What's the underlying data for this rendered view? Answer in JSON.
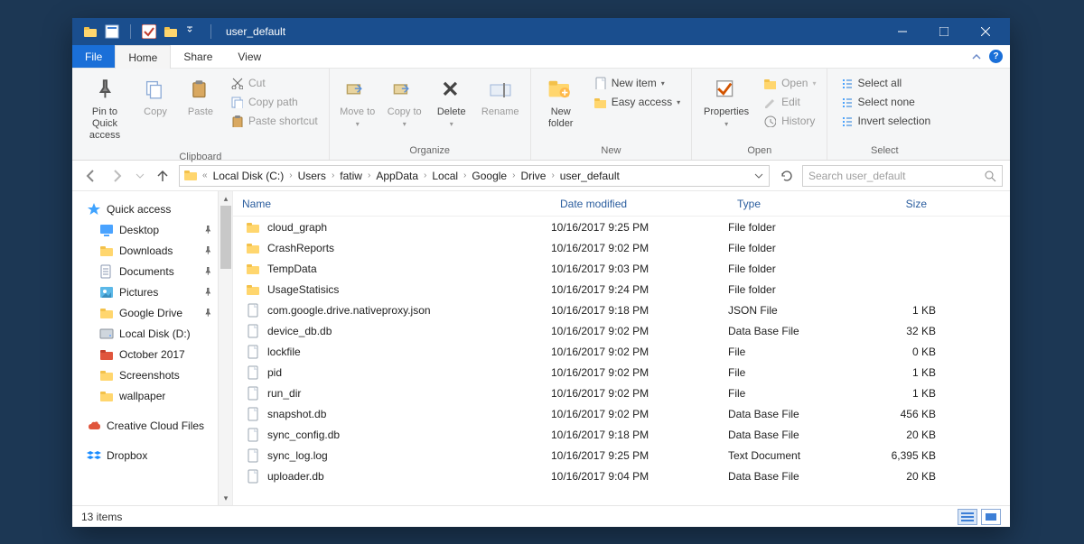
{
  "window": {
    "title": "user_default"
  },
  "tabs": {
    "file": "File",
    "home": "Home",
    "share": "Share",
    "view": "View"
  },
  "ribbon": {
    "clipboard": {
      "label": "Clipboard",
      "pin": "Pin to Quick access",
      "copy": "Copy",
      "paste": "Paste",
      "cut": "Cut",
      "copy_path": "Copy path",
      "paste_shortcut": "Paste shortcut"
    },
    "organize": {
      "label": "Organize",
      "move_to": "Move to",
      "copy_to": "Copy to",
      "delete": "Delete",
      "rename": "Rename"
    },
    "new": {
      "label": "New",
      "new_folder": "New folder",
      "new_item": "New item",
      "easy_access": "Easy access"
    },
    "open": {
      "label": "Open",
      "properties": "Properties",
      "open": "Open",
      "edit": "Edit",
      "history": "History"
    },
    "select": {
      "label": "Select",
      "select_all": "Select all",
      "select_none": "Select none",
      "invert": "Invert selection"
    }
  },
  "breadcrumb": [
    "Local Disk (C:)",
    "Users",
    "fatiw",
    "AppData",
    "Local",
    "Google",
    "Drive",
    "user_default"
  ],
  "search": {
    "placeholder": "Search user_default"
  },
  "sidebar": {
    "quick_access": "Quick access",
    "items": [
      {
        "label": "Desktop",
        "pinned": true,
        "icon": "desktop"
      },
      {
        "label": "Downloads",
        "pinned": true,
        "icon": "folder"
      },
      {
        "label": "Documents",
        "pinned": true,
        "icon": "documents"
      },
      {
        "label": "Pictures",
        "pinned": true,
        "icon": "pictures"
      },
      {
        "label": "Google Drive",
        "pinned": true,
        "icon": "folder"
      },
      {
        "label": "Local Disk (D:)",
        "pinned": false,
        "icon": "disk"
      },
      {
        "label": "October 2017",
        "pinned": false,
        "icon": "folder-red"
      },
      {
        "label": "Screenshots",
        "pinned": false,
        "icon": "folder"
      },
      {
        "label": "wallpaper",
        "pinned": false,
        "icon": "folder"
      }
    ],
    "cc": "Creative Cloud Files",
    "dropbox": "Dropbox"
  },
  "columns": {
    "name": "Name",
    "date": "Date modified",
    "type": "Type",
    "size": "Size"
  },
  "files": [
    {
      "name": "cloud_graph",
      "date": "10/16/2017 9:25 PM",
      "type": "File folder",
      "size": "",
      "icon": "folder"
    },
    {
      "name": "CrashReports",
      "date": "10/16/2017 9:02 PM",
      "type": "File folder",
      "size": "",
      "icon": "folder"
    },
    {
      "name": "TempData",
      "date": "10/16/2017 9:03 PM",
      "type": "File folder",
      "size": "",
      "icon": "folder"
    },
    {
      "name": "UsageStatisics",
      "date": "10/16/2017 9:24 PM",
      "type": "File folder",
      "size": "",
      "icon": "folder"
    },
    {
      "name": "com.google.drive.nativeproxy.json",
      "date": "10/16/2017 9:18 PM",
      "type": "JSON File",
      "size": "1 KB",
      "icon": "file"
    },
    {
      "name": "device_db.db",
      "date": "10/16/2017 9:02 PM",
      "type": "Data Base File",
      "size": "32 KB",
      "icon": "file"
    },
    {
      "name": "lockfile",
      "date": "10/16/2017 9:02 PM",
      "type": "File",
      "size": "0 KB",
      "icon": "file"
    },
    {
      "name": "pid",
      "date": "10/16/2017 9:02 PM",
      "type": "File",
      "size": "1 KB",
      "icon": "file"
    },
    {
      "name": "run_dir",
      "date": "10/16/2017 9:02 PM",
      "type": "File",
      "size": "1 KB",
      "icon": "file"
    },
    {
      "name": "snapshot.db",
      "date": "10/16/2017 9:02 PM",
      "type": "Data Base File",
      "size": "456 KB",
      "icon": "file"
    },
    {
      "name": "sync_config.db",
      "date": "10/16/2017 9:18 PM",
      "type": "Data Base File",
      "size": "20 KB",
      "icon": "file"
    },
    {
      "name": "sync_log.log",
      "date": "10/16/2017 9:25 PM",
      "type": "Text Document",
      "size": "6,395 KB",
      "icon": "file"
    },
    {
      "name": "uploader.db",
      "date": "10/16/2017 9:04 PM",
      "type": "Data Base File",
      "size": "20 KB",
      "icon": "file"
    }
  ],
  "status": {
    "count": "13 items"
  }
}
